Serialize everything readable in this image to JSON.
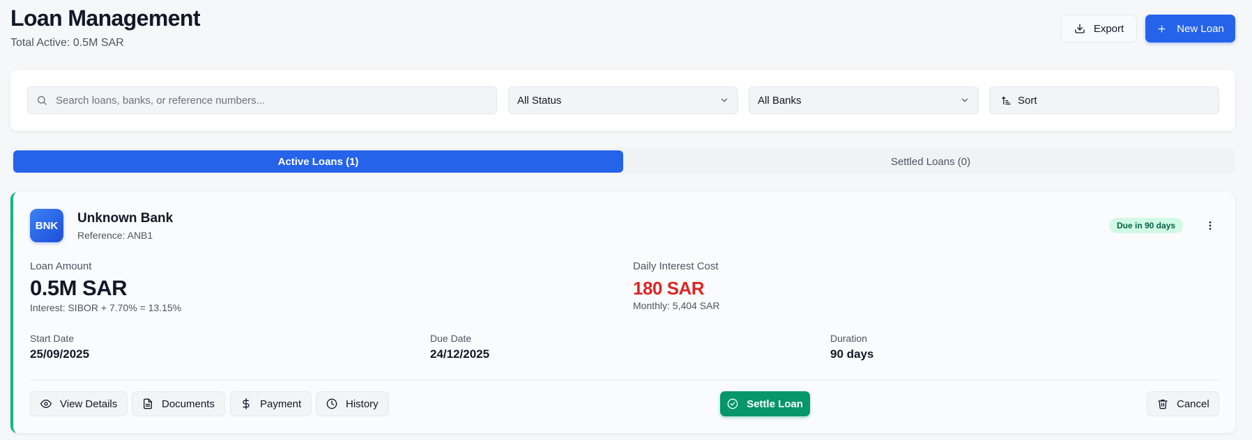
{
  "header": {
    "title": "Loan Management",
    "subtitle": "Total Active: 0.5M SAR",
    "export_label": "Export",
    "new_loan_label": "New Loan"
  },
  "filters": {
    "search_placeholder": "Search loans, banks, or reference numbers...",
    "status_value": "All Status",
    "bank_value": "All Banks",
    "sort_label": "Sort"
  },
  "tabs": [
    {
      "label": "Active Loans (1)",
      "active": true
    },
    {
      "label": "Settled Loans (0)",
      "active": false
    }
  ],
  "loan": {
    "logo_text": "BNK",
    "bank_name": "Unknown Bank",
    "reference": "Reference: ANB1",
    "due_badge": "Due in 90 days",
    "loan_amount_label": "Loan Amount",
    "loan_amount": "0.5M SAR",
    "interest": "Interest: SIBOR + 7.70% = 13.15%",
    "daily_cost_label": "Daily Interest Cost",
    "daily_cost": "180 SAR",
    "monthly": "Monthly: 5,404 SAR",
    "start_label": "Start Date",
    "start_date": "25/09/2025",
    "due_label": "Due Date",
    "due_date": "24/12/2025",
    "duration_label": "Duration",
    "duration": "90 days",
    "actions": {
      "view_details": "View Details",
      "documents": "Documents",
      "payment": "Payment",
      "history": "History",
      "settle": "Settle Loan",
      "cancel": "Cancel"
    }
  },
  "colors": {
    "primary": "#2563eb",
    "success": "#059669",
    "accent_border": "#10b981",
    "danger": "#dc2626",
    "badge_bg": "#d1fae5"
  },
  "icons": [
    "download-icon",
    "plus-icon",
    "search-icon",
    "chevron-down-icon",
    "sort-icon",
    "more-vertical-icon",
    "eye-icon",
    "document-icon",
    "dollar-icon",
    "clock-icon",
    "check-circle-icon",
    "trash-icon"
  ]
}
